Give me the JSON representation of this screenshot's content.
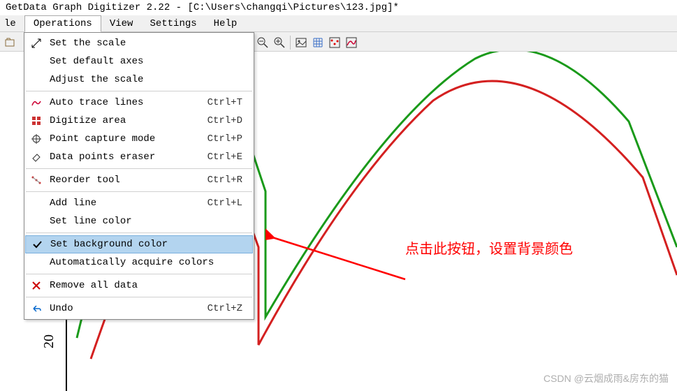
{
  "window": {
    "title": "GetData Graph Digitizer 2.22 - [C:\\Users\\changqi\\Pictures\\123.jpg]*"
  },
  "menubar": {
    "file_partial": "le",
    "operations": "Operations",
    "view": "View",
    "settings": "Settings",
    "help": "Help"
  },
  "dropdown": {
    "set_scale": "Set the scale",
    "set_default_axes": "Set default axes",
    "adjust_scale": "Adjust the scale",
    "auto_trace": "Auto trace lines",
    "auto_trace_sc": "Ctrl+T",
    "digitize_area": "Digitize area",
    "digitize_area_sc": "Ctrl+D",
    "point_capture": "Point capture mode",
    "point_capture_sc": "Ctrl+P",
    "eraser": "Data points eraser",
    "eraser_sc": "Ctrl+E",
    "reorder": "Reorder tool",
    "reorder_sc": "Ctrl+R",
    "add_line": "Add line",
    "add_line_sc": "Ctrl+L",
    "set_line_color": "Set line color",
    "set_bg_color": "Set background color",
    "auto_acquire": "Automatically acquire colors",
    "remove_all": "Remove all data",
    "undo": "Undo",
    "undo_sc": "Ctrl+Z"
  },
  "annotation": {
    "text": "点击此按钮，设置背景颜色"
  },
  "watermark": "CSDN @云烟成雨&房东的猫"
}
